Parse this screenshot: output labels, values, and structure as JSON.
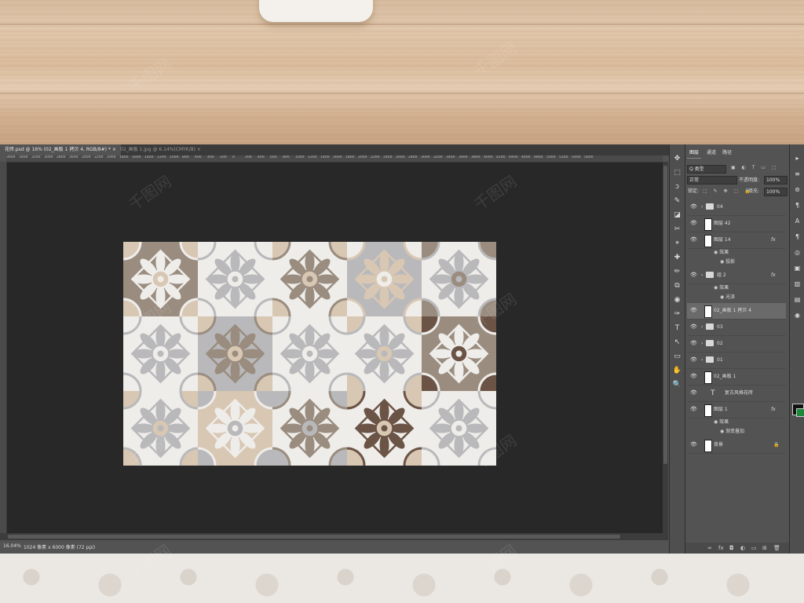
{
  "tabs": [
    {
      "label": "花砖.psd @ 16% (02_画板 1 拷贝 4, RGB/8#) *",
      "close": "×"
    },
    {
      "label": "02_画板 1.jpg @ 6.14%(CMYK/8)",
      "close": "×"
    }
  ],
  "ruler_top": [
    "3600",
    "3400",
    "3200",
    "3000",
    "2800",
    "2600",
    "2400",
    "2200",
    "2000",
    "1800",
    "1600",
    "1400",
    "1200",
    "1000",
    "800",
    "600",
    "400",
    "200",
    "0",
    "200",
    "400",
    "600",
    "800",
    "1000",
    "1200",
    "1400",
    "1600",
    "1800",
    "2000",
    "2200",
    "2400",
    "2600",
    "2800",
    "3000",
    "3200",
    "3400",
    "3600",
    "3800",
    "4000",
    "4200",
    "4400",
    "4600",
    "4800",
    "5000",
    "5200",
    "5400",
    "5600"
  ],
  "status": {
    "zoom": "16.04%",
    "doc": "1024 像素 x 6000 像素 (72 ppi)"
  },
  "layers_panel": {
    "tabs": [
      "图层",
      "通道",
      "路径"
    ],
    "filter_label": "Q 类型",
    "blend_mode": "正常",
    "opacity_label": "不透明度:",
    "opacity_value": "100%",
    "lock_label": "锁定:",
    "fill_label": "填充:",
    "fill_value": "100%",
    "layers": [
      {
        "name": "04",
        "kind": "group"
      },
      {
        "name": "图层 42",
        "kind": "layer"
      },
      {
        "name": "图层 14",
        "kind": "layer",
        "fx": "fx"
      },
      {
        "name": "效果",
        "kind": "sub"
      },
      {
        "name": "投影",
        "kind": "sub"
      },
      {
        "name": "组 2",
        "kind": "group",
        "fx": "fx"
      },
      {
        "name": "效果",
        "kind": "sub"
      },
      {
        "name": "光泽",
        "kind": "sub"
      },
      {
        "name": "02_画板 1 拷贝 4",
        "kind": "layer",
        "selected": true
      },
      {
        "name": "03",
        "kind": "group"
      },
      {
        "name": "02",
        "kind": "group"
      },
      {
        "name": "01",
        "kind": "group"
      },
      {
        "name": "02_画板 1",
        "kind": "layer"
      },
      {
        "name": "复古风格花砖",
        "kind": "text"
      },
      {
        "name": "图层 1",
        "kind": "layer",
        "fx": "fx"
      },
      {
        "name": "效果",
        "kind": "sub"
      },
      {
        "name": "渐变叠加",
        "kind": "sub"
      },
      {
        "name": "背景",
        "kind": "background",
        "lock": "🔒"
      }
    ],
    "bottom_icons": [
      "link-icon",
      "fx-icon",
      "mask-icon",
      "adjustment-icon",
      "group-icon",
      "new-layer-icon",
      "trash-icon"
    ],
    "bottom_glyphs": [
      "∞",
      "fx",
      "◘",
      "◐",
      "▭",
      "⊞",
      "🗑"
    ]
  },
  "tools_glyphs": [
    "✥",
    "⬚",
    "ↄ",
    "✎",
    "◪",
    "✂",
    "⌖",
    "✚",
    "✏",
    "⧉",
    "◉",
    "✑",
    "T",
    "↖",
    "▭",
    "✋",
    "🔍"
  ],
  "rtools_glyphs": [
    "▸",
    "≡",
    "⊚",
    "¶",
    "A",
    "¶",
    "◎",
    "▣",
    "▥",
    "▤",
    "◉"
  ],
  "watermark": "千图网",
  "colors": {
    "tile_light": "#efedea",
    "tile_beige": "#d8c7b3",
    "tile_taupe": "#9a8d80",
    "tile_gray": "#b9b9bb",
    "tile_brown": "#6b5446"
  }
}
